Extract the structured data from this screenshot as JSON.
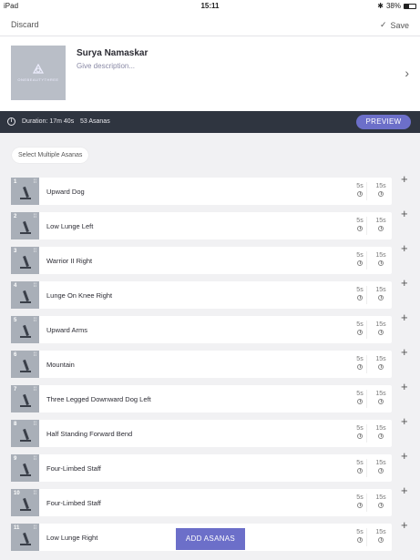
{
  "status": {
    "device": "iPad",
    "time": "15:11",
    "battery": "38%"
  },
  "nav": {
    "discard_label": "Discard",
    "save_label": "Save"
  },
  "sequence": {
    "title": "Surya Namaskar",
    "description_placeholder": "Give description...",
    "thumb_logo_text": "ONEBEAUTYTHREE"
  },
  "info": {
    "duration": "Duration: 17m 40s",
    "count": "53 Asanas",
    "preview_label": "PREVIEW"
  },
  "select_multiple_label": "Select Multiple Asanas",
  "asanas": [
    {
      "num": "1",
      "name": "Upward Dog",
      "t1": "5s",
      "t2": "15s"
    },
    {
      "num": "2",
      "name": "Low Lunge Left",
      "t1": "5s",
      "t2": "15s"
    },
    {
      "num": "3",
      "name": "Warrior II Right",
      "t1": "5s",
      "t2": "15s"
    },
    {
      "num": "4",
      "name": "Lunge On Knee Right",
      "t1": "5s",
      "t2": "15s"
    },
    {
      "num": "5",
      "name": "Upward Arms",
      "t1": "5s",
      "t2": "15s"
    },
    {
      "num": "6",
      "name": "Mountain",
      "t1": "5s",
      "t2": "15s"
    },
    {
      "num": "7",
      "name": "Three Legged Downward Dog Left",
      "t1": "5s",
      "t2": "15s"
    },
    {
      "num": "8",
      "name": "Half Standing Forward Bend",
      "t1": "5s",
      "t2": "15s"
    },
    {
      "num": "9",
      "name": "Four-Limbed Staff",
      "t1": "5s",
      "t2": "15s"
    },
    {
      "num": "10",
      "name": "Four-Limbed Staff",
      "t1": "5s",
      "t2": "15s"
    },
    {
      "num": "11",
      "name": "Low Lunge Right",
      "t1": "5s",
      "t2": "15s"
    }
  ],
  "add_asanas_label": "ADD ASANAS",
  "colors": {
    "accent": "#6c6fc9",
    "info_bar": "#2f3540",
    "background": "#f1f1f3"
  }
}
